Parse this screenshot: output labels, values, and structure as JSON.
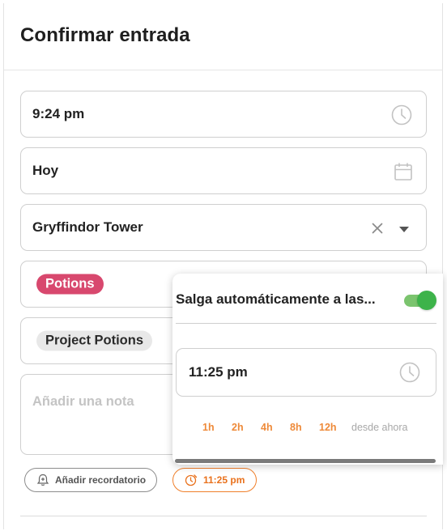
{
  "dialog": {
    "title": "Confirmar entrada"
  },
  "fields": {
    "time": {
      "value": "9:24 pm",
      "icon": "clock-icon"
    },
    "date": {
      "value": "Hoy",
      "icon": "calendar-icon"
    },
    "location": {
      "value": "Gryffindor Tower",
      "clear_icon": "close-icon",
      "dropdown_icon": "caret-down-icon"
    },
    "tag": {
      "label": "Potions",
      "color": "#d8486e"
    },
    "project": {
      "label": "Project Potions"
    },
    "note": {
      "placeholder": "Añadir una nota"
    }
  },
  "actions": {
    "reminder_label": "Añadir recordatorio",
    "end_time_label": "11:25 pm",
    "accent_color": "#e9711c"
  },
  "popover": {
    "auto_exit_label": "Salga automáticamente a las...",
    "auto_exit_enabled": true,
    "time_value": "11:25 pm",
    "quick_options": [
      "1h",
      "2h",
      "4h",
      "8h",
      "12h"
    ],
    "quick_suffix": "desde ahora",
    "toggle_color": "#3db34a"
  }
}
